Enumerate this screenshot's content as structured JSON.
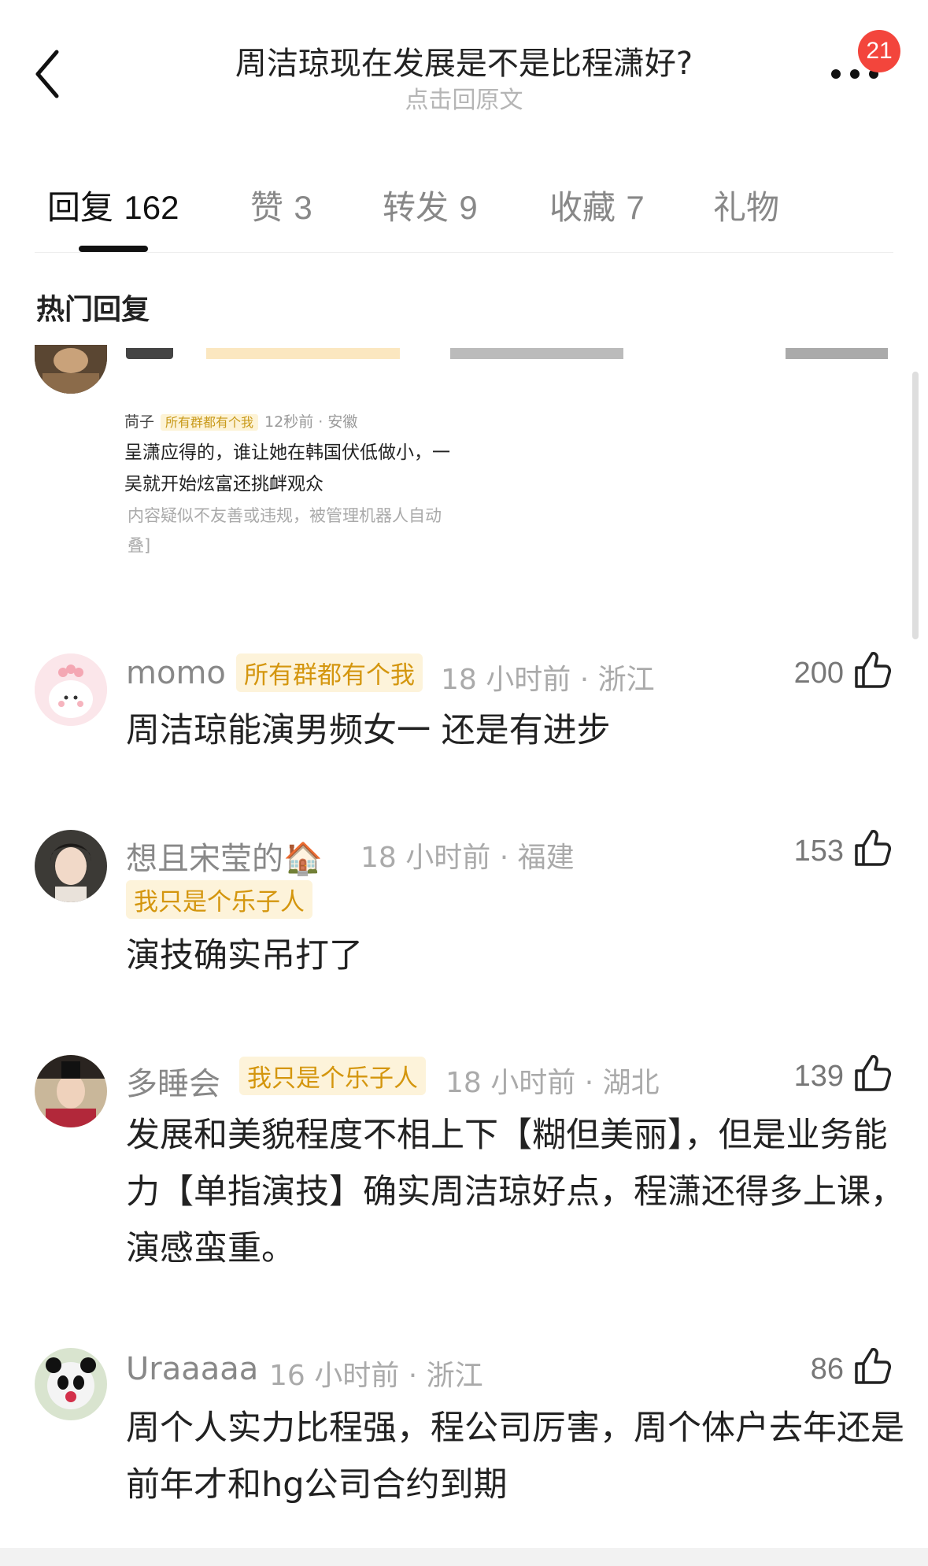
{
  "header": {
    "title": "周洁琼现在发展是不是比程潇好?",
    "subtitle": "点击回原文",
    "badge_count": "21"
  },
  "tabs": [
    {
      "label": "回复",
      "count": "162",
      "active": true
    },
    {
      "label": "赞",
      "count": "3",
      "active": false
    },
    {
      "label": "转发",
      "count": "9",
      "active": false
    },
    {
      "label": "收藏",
      "count": "7",
      "active": false
    },
    {
      "label": "礼物",
      "count": "",
      "active": false
    }
  ],
  "section_title": "热门回复",
  "embedded_screenshot": {
    "name": "苘子",
    "tag": "所有群都有个我",
    "meta": "12秒前 · 安徽",
    "line1": "呈潇应得的，谁让她在韩国伏低做小，一",
    "line2": "吴就开始炫富还挑衅观众",
    "notice1": "内容疑似不友善或违规，被管理机器人自动",
    "notice2": "叠]"
  },
  "comments": [
    {
      "username": "momo",
      "tag": "所有群都有个我",
      "meta": "18 小时前 · 浙江",
      "likes": "200",
      "text": "周洁琼能演男频女一 还是有进步"
    },
    {
      "username": "想且宋莹的🏠",
      "tag": "我只是个乐子人",
      "meta": "18 小时前 · 福建",
      "likes": "153",
      "text": "演技确实吊打了"
    },
    {
      "username": "多睡会",
      "tag": "我只是个乐子人",
      "meta": "18 小时前 · 湖北",
      "likes": "139",
      "text": "发展和美貌程度不相上下【糊但美丽】，但是业务能力【单指演技】确实周洁琼好点，程潇还得多上课，演感蛮重。"
    },
    {
      "username": "Uraaaaa",
      "tag": "",
      "meta": "16 小时前 · 浙江",
      "likes": "86",
      "text": "周个人实力比程强，程公司厉害，周个体户去年还是前年才和hg公司合约到期"
    }
  ],
  "icons": {
    "back": "chevron-left-icon",
    "more": "more-dots-icon",
    "like": "thumbs-up-icon"
  },
  "colors": {
    "badge": "#f3453c",
    "tag_text": "#d4960e",
    "tag_bg": "#fdf3da"
  }
}
